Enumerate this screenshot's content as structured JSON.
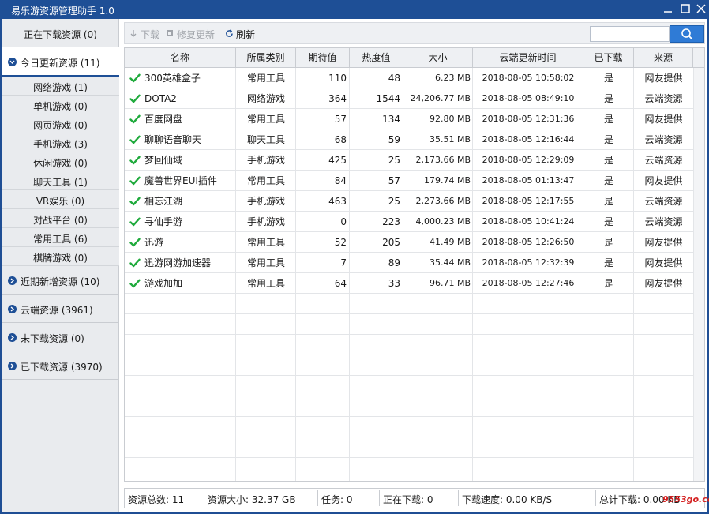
{
  "window": {
    "title": "易乐游资源管理助手 1.0"
  },
  "sidebar": {
    "top_item": "正在下载资源 (0)",
    "today_item": "今日更新资源 (11)",
    "sub_items": [
      {
        "label": "网络游戏 (1)"
      },
      {
        "label": "单机游戏 (0)"
      },
      {
        "label": "网页游戏 (0)"
      },
      {
        "label": "手机游戏 (3)"
      },
      {
        "label": "休闲游戏 (0)"
      },
      {
        "label": "聊天工具 (1)"
      },
      {
        "label": "VR娱乐 (0)"
      },
      {
        "label": "对战平台 (0)"
      },
      {
        "label": "常用工具 (6)"
      },
      {
        "label": "棋牌游戏 (0)"
      }
    ],
    "bottom_items": [
      {
        "label": "近期新增资源 (10)"
      },
      {
        "label": "云端资源 (3961)"
      },
      {
        "label": "未下载资源 (0)"
      },
      {
        "label": "已下载资源 (3970)"
      }
    ]
  },
  "toolbar": {
    "download_label": "下载",
    "repair_label": "修复更新",
    "refresh_label": "刷新",
    "search_value": ""
  },
  "table": {
    "columns": [
      "名称",
      "所属类别",
      "期待值",
      "热度值",
      "大小",
      "云端更新时间",
      "已下载",
      "来源"
    ],
    "rows": [
      {
        "name": "300英雄盒子",
        "category": "常用工具",
        "expect": "110",
        "heat": "48",
        "size": "6.23 MB",
        "time": "2018-08-05 10:58:02",
        "downloaded": "是",
        "source": "网友提供"
      },
      {
        "name": "DOTA2",
        "category": "网络游戏",
        "expect": "364",
        "heat": "1544",
        "size": "24,206.77 MB",
        "time": "2018-08-05 08:49:10",
        "downloaded": "是",
        "source": "云端资源"
      },
      {
        "name": "百度网盘",
        "category": "常用工具",
        "expect": "57",
        "heat": "134",
        "size": "92.80 MB",
        "time": "2018-08-05 12:31:36",
        "downloaded": "是",
        "source": "网友提供"
      },
      {
        "name": "聊聊语音聊天",
        "category": "聊天工具",
        "expect": "68",
        "heat": "59",
        "size": "35.51 MB",
        "time": "2018-08-05 12:16:44",
        "downloaded": "是",
        "source": "云端资源"
      },
      {
        "name": "梦回仙域",
        "category": "手机游戏",
        "expect": "425",
        "heat": "25",
        "size": "2,173.66 MB",
        "time": "2018-08-05 12:29:09",
        "downloaded": "是",
        "source": "云端资源"
      },
      {
        "name": "魔兽世界EUI插件",
        "category": "常用工具",
        "expect": "84",
        "heat": "57",
        "size": "179.74 MB",
        "time": "2018-08-05 01:13:47",
        "downloaded": "是",
        "source": "网友提供"
      },
      {
        "name": "相忘江湖",
        "category": "手机游戏",
        "expect": "463",
        "heat": "25",
        "size": "2,273.66 MB",
        "time": "2018-08-05 12:17:55",
        "downloaded": "是",
        "source": "云端资源"
      },
      {
        "name": "寻仙手游",
        "category": "手机游戏",
        "expect": "0",
        "heat": "223",
        "size": "4,000.23 MB",
        "time": "2018-08-05 10:41:24",
        "downloaded": "是",
        "source": "云端资源"
      },
      {
        "name": "迅游",
        "category": "常用工具",
        "expect": "52",
        "heat": "205",
        "size": "41.49 MB",
        "time": "2018-08-05 12:26:50",
        "downloaded": "是",
        "source": "网友提供"
      },
      {
        "name": "迅游网游加速器",
        "category": "常用工具",
        "expect": "7",
        "heat": "89",
        "size": "35.44 MB",
        "time": "2018-08-05 12:32:39",
        "downloaded": "是",
        "source": "网友提供"
      },
      {
        "name": "游戏加加",
        "category": "常用工具",
        "expect": "64",
        "heat": "33",
        "size": "96.71 MB",
        "time": "2018-08-05 12:27:46",
        "downloaded": "是",
        "source": "网友提供"
      }
    ]
  },
  "status": {
    "total": "资源总数: 11",
    "size": "资源大小: 32.37 GB",
    "tasks": "任务: 0",
    "downloading": "正在下载: 0",
    "speed": "下载速度: 0.00 KB/S",
    "total_speed": "总计下载: 0.00 KB"
  },
  "watermark": "9553go.com",
  "colors": {
    "title_bar": "#1e4f96",
    "accent": "#2f7bd6",
    "check": "#1faa3c"
  }
}
